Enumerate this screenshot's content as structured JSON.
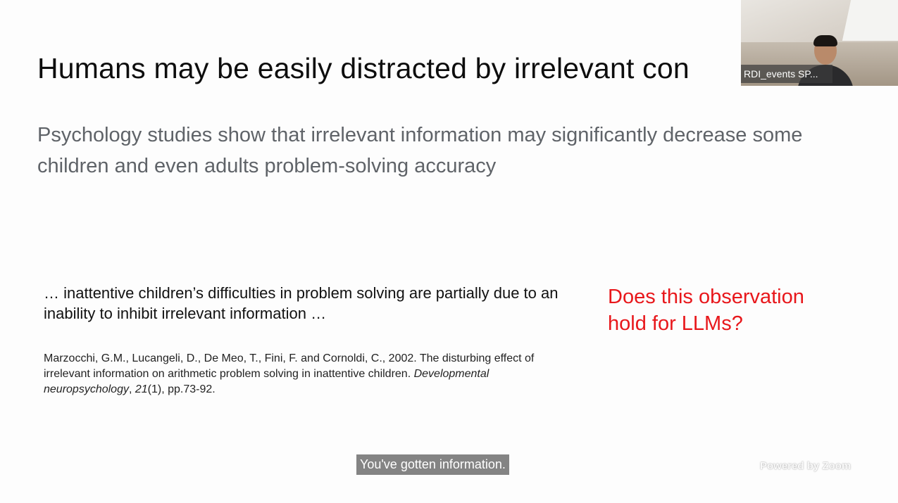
{
  "slide": {
    "title": "Humans may be easily distracted by irrelevant con",
    "subtitle": "Psychology studies show that irrelevant information may significantly decrease some children and even adults problem-solving accuracy",
    "quote": "… inattentive children’s difficulties in problem solving are partially due to an inability to inhibit irrelevant information …",
    "citation": {
      "authors": "Marzocchi, G.M., Lucangeli, D., De Meo, T., Fini, F. and Cornoldi, C., 2002. The disturbing effect of irrelevant information on arithmetic problem solving in inattentive children. ",
      "journal": "Developmental neuropsychology",
      "sep": ", ",
      "volume": "21",
      "rest": "(1), pp.73-92."
    },
    "question": "Does this observation hold for LLMs?"
  },
  "video": {
    "participant_name": "RDI_events SP..."
  },
  "caption": {
    "text": "You've gotten information."
  },
  "branding": {
    "powered_by": "Powered by Zoom"
  },
  "colors": {
    "accent_red": "#e8171b",
    "subtitle_gray": "#5f6368"
  }
}
